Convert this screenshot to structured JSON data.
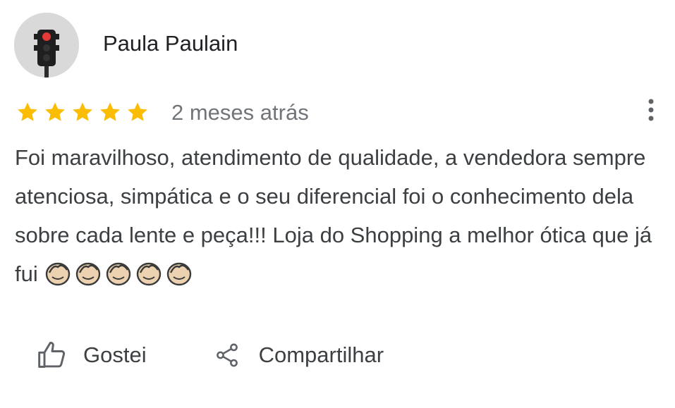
{
  "reviewer": {
    "name": "Paula Paulain",
    "avatar_icon": "traffic-light-icon"
  },
  "rating": {
    "stars": 5,
    "max": 5,
    "color": "#fbbc04"
  },
  "time_ago": "2 meses atrás",
  "review": {
    "text": "Foi maravilhoso, atendimento de qualidade, a vendedora sempre atenciosa, simpática e o seu diferencial foi o conhecimento dela sobre cada lente e peça!!! Loja do Shopping a melhor ótica que já fui",
    "emoji_icon": "clapping-hands-icon",
    "emoji_count": 5
  },
  "actions": {
    "like_label": "Gostei",
    "share_label": "Compartilhar"
  },
  "more_icon": "more-vertical-icon"
}
